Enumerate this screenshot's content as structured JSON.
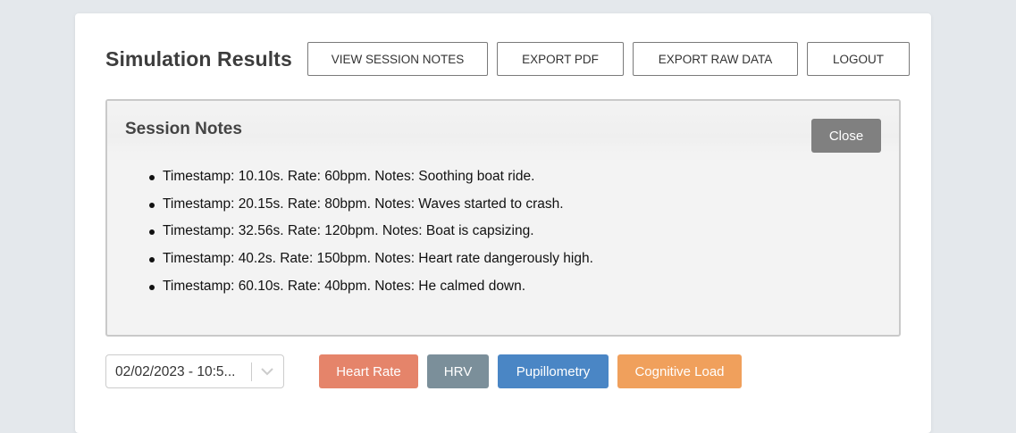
{
  "header": {
    "title": "Simulation Results",
    "buttons": {
      "view_notes": "VIEW SESSION NOTES",
      "export_pdf": "EXPORT PDF",
      "export_raw": "EXPORT RAW DATA",
      "logout": "LOGOUT"
    }
  },
  "session_notes": {
    "title": "Session Notes",
    "close_label": "Close",
    "items": [
      "Timestamp: 10.10s. Rate: 60bpm. Notes: Soothing boat ride.",
      "Timestamp: 20.15s. Rate: 80bpm. Notes: Waves started to crash.",
      "Timestamp: 32.56s. Rate: 120bpm. Notes: Boat is capsizing.",
      "Timestamp: 40.2s. Rate: 150bpm. Notes: Heart rate dangerously high.",
      "Timestamp: 60.10s. Rate: 40bpm. Notes: He calmed down."
    ]
  },
  "session_select": {
    "selected": "02/02/2023 - 10:5...",
    "icon": "chevron-down-icon"
  },
  "metrics": [
    {
      "label": "Heart Rate",
      "color": "#e5846a"
    },
    {
      "label": "HRV",
      "color": "#7b8f9a"
    },
    {
      "label": "Pupillometry",
      "color": "#4a86c5"
    },
    {
      "label": "Cognitive Load",
      "color": "#f0a05c"
    }
  ]
}
